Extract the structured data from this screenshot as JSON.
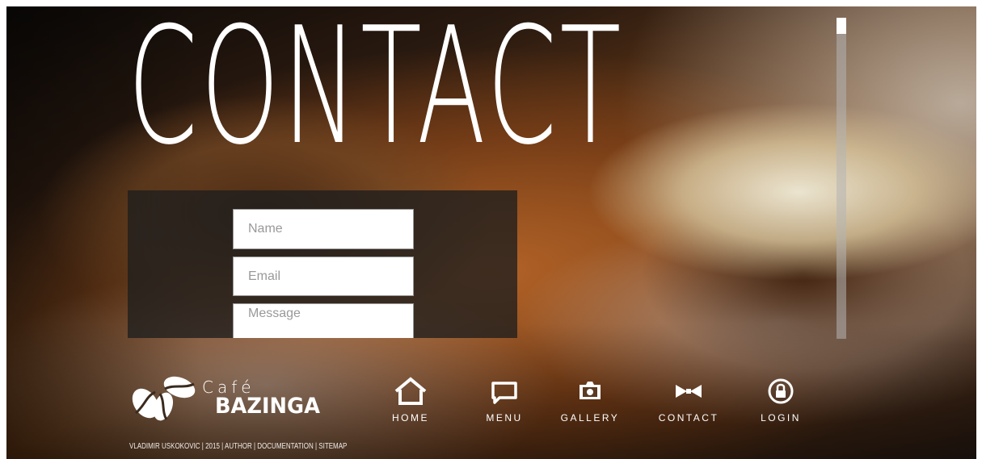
{
  "page": {
    "title": "CONTACT"
  },
  "contact_form": {
    "name_placeholder": "Name",
    "email_placeholder": "Email",
    "message_placeholder": "Message"
  },
  "logo": {
    "cafe": "Café",
    "name": "BAZINGA"
  },
  "nav": {
    "items": [
      {
        "label": "HOME",
        "icon": "home-icon"
      },
      {
        "label": "MENU",
        "icon": "chat-bubble-icon"
      },
      {
        "label": "GALLERY",
        "icon": "camera-icon"
      },
      {
        "label": "CONTACT",
        "icon": "bowtie-icon"
      },
      {
        "label": "LOGIN",
        "icon": "lock-icon"
      }
    ]
  },
  "footer": {
    "text": "VLADIMIR USKOKOVIC | 2015 | AUTHOR | DOCUMENTATION | SITEMAP"
  },
  "colors": {
    "text": "#ffffff",
    "panel": "#1e1e1e",
    "scrollbar": "#b4b4b4"
  }
}
